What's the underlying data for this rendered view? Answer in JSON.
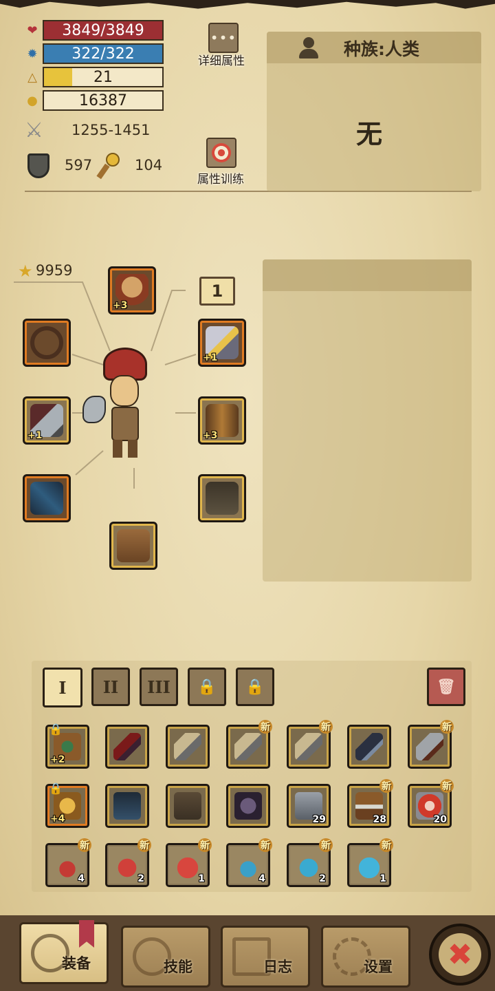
{
  "stats": {
    "hp": "3849/3849",
    "mp": "322/322",
    "level": "21",
    "gold": "16387",
    "attack": "1255-1451",
    "armor": "597",
    "magic_resist": "104"
  },
  "stat_fill": {
    "hp": 1.0,
    "mp": 1.0,
    "level_exp": 0.24
  },
  "buttons": {
    "detail_attributes": "详细属性",
    "attribute_training": "属性训练"
  },
  "race_panel": {
    "label": "种族:人类",
    "value": "无"
  },
  "power_score": "9959",
  "page_number": "1",
  "equipment": {
    "head_plus": "+3",
    "amulet_plus": "+1",
    "weapon_plus": "+1",
    "gloves_plus": "+3"
  },
  "bag_tabs": [
    "I",
    "II",
    "III"
  ],
  "inventory": {
    "row1": [
      {
        "name": "shield",
        "plus": "+2",
        "locked": true,
        "new": ""
      },
      {
        "name": "red-blade",
        "plus": "",
        "locked": false,
        "new": ""
      },
      {
        "name": "mace",
        "plus": "",
        "locked": false,
        "new": ""
      },
      {
        "name": "mace",
        "plus": "",
        "locked": false,
        "new": "新"
      },
      {
        "name": "mace",
        "plus": "",
        "locked": false,
        "new": "新"
      },
      {
        "name": "dark-sword",
        "plus": "",
        "locked": false,
        "new": ""
      },
      {
        "name": "broad-sword",
        "plus": "",
        "locked": false,
        "new": "新"
      }
    ],
    "row2": [
      {
        "name": "gold-shoulder",
        "plus": "+4",
        "locked": true,
        "count": "",
        "new": ""
      },
      {
        "name": "blue-armor",
        "plus": "",
        "locked": false,
        "count": "",
        "new": ""
      },
      {
        "name": "leather-pants",
        "plus": "",
        "locked": false,
        "count": "",
        "new": ""
      },
      {
        "name": "dark-bracer",
        "plus": "",
        "locked": false,
        "count": "",
        "new": ""
      },
      {
        "name": "iron-ore",
        "plus": "",
        "locked": false,
        "count": "29",
        "new": ""
      },
      {
        "name": "chest",
        "plus": "",
        "locked": false,
        "count": "28",
        "new": "新"
      },
      {
        "name": "red-gem",
        "plus": "",
        "locked": false,
        "count": "20",
        "new": "新"
      }
    ],
    "row3": [
      {
        "name": "small-red-potion",
        "count": "4",
        "new": "新"
      },
      {
        "name": "medium-red-potion",
        "count": "2",
        "new": "新"
      },
      {
        "name": "large-red-potion",
        "count": "1",
        "new": "新"
      },
      {
        "name": "small-blue-potion",
        "count": "4",
        "new": "新"
      },
      {
        "name": "medium-blue-potion",
        "count": "2",
        "new": "新"
      },
      {
        "name": "large-blue-potion",
        "count": "1",
        "new": "新"
      }
    ]
  },
  "nav": {
    "equipment": "装备",
    "skills": "技能",
    "journal": "日志",
    "settings": "设置"
  },
  "colors": {
    "hp": "#9c2f33",
    "mp": "#3a7eb2",
    "exp": "#e7c33c",
    "parchment": "#e9dbb0",
    "close": "#d9443a"
  }
}
